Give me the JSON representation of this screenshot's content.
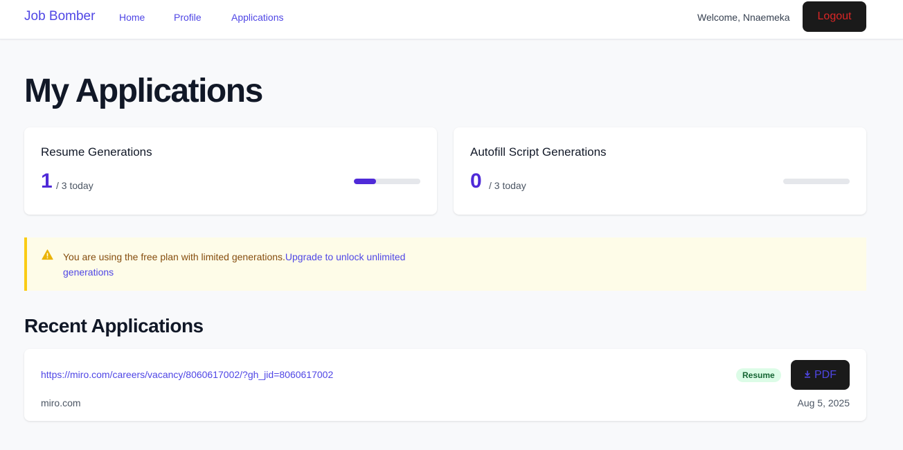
{
  "nav": {
    "brand": "Job Bomber",
    "links": [
      "Home",
      "Profile",
      "Applications"
    ],
    "welcome": "Welcome, Nnaemeka",
    "logout_label": "Logout"
  },
  "page": {
    "title": "My Applications"
  },
  "stats": [
    {
      "title": "Resume Generations",
      "value": "1",
      "suffix": "/ 3 today",
      "used": 1,
      "limit": 3
    },
    {
      "title": "Autofill Script Generations",
      "value": "0",
      "suffix": "/ 3 today",
      "used": 0,
      "limit": 3
    }
  ],
  "alert": {
    "icon": "warning-icon",
    "message": "You are using the free plan with limited generations.",
    "link_label": "Upgrade to unlock unlimited generations"
  },
  "recent": {
    "title": "Recent Applications",
    "items": [
      {
        "url": "https://miro.com/careers/vacancy/8060617002/?gh_jid=8060617002",
        "domain": "miro.com",
        "badge": "Resume",
        "button_label": "PDF",
        "button_icon": "download-icon",
        "date": "Aug 5, 2025"
      }
    ]
  },
  "colors": {
    "accent": "#4f46e5",
    "stat_value": "#4f2ad8",
    "logout_text": "#dc2626",
    "alert_bg": "#fefce8",
    "alert_border": "#facc15",
    "badge_bg": "#dcfce7",
    "badge_text": "#166534"
  }
}
